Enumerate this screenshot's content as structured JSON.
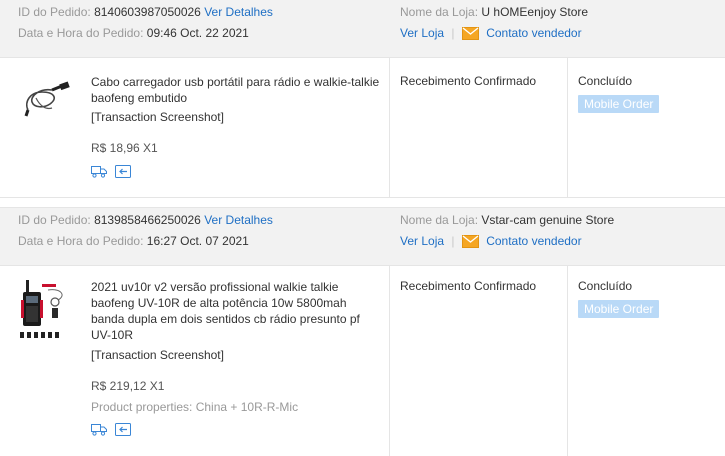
{
  "orders": [
    {
      "order_id_label": "ID do Pedido:",
      "order_id": "8140603987050026",
      "details_link": "Ver Detalhes",
      "date_label": "Data e Hora do Pedido:",
      "date_value": "09:46 Oct. 22 2021",
      "store_label": "Nome da Loja:",
      "store_name": "U hOMEenjoy Store",
      "view_store": "Ver Loja",
      "contact_seller": "Contato vendedor",
      "product_title": "Cabo carregador usb portátil para rádio e walkie-talkie baofeng embutido",
      "snapshot": "[Transaction Screenshot]",
      "price": "R$ 18,96 X1",
      "properties": "",
      "status": "Recebimento Confirmado",
      "state": "Concluído",
      "badge": "Mobile Order"
    },
    {
      "order_id_label": "ID do Pedido:",
      "order_id": "8139858466250026",
      "details_link": "Ver Detalhes",
      "date_label": "Data e Hora do Pedido:",
      "date_value": "16:27 Oct. 07 2021",
      "store_label": "Nome da Loja:",
      "store_name": "Vstar-cam genuine Store",
      "view_store": "Ver Loja",
      "contact_seller": "Contato vendedor",
      "product_title": "2021 uv10r v2 versão profissional walkie talkie baofeng UV-10R de alta potência 10w 5800mah banda dupla em dois sentidos cb rádio presunto pf UV-10R",
      "snapshot": "[Transaction Screenshot]",
      "price": "R$ 219,12 X1",
      "properties": "Product properties: China + 10R-R-Mic",
      "status": "Recebimento Confirmado",
      "state": "Concluído",
      "badge": "Mobile Order"
    }
  ],
  "colors": {
    "link": "#1f6fc4",
    "header_bg": "#f2f2f2",
    "badge_bg": "#b9d9f7",
    "mail_icon": "#f5a623"
  },
  "icons": [
    "truck-icon",
    "return-icon",
    "mail-icon",
    "cable-thumbnail",
    "radio-thumbnail"
  ]
}
